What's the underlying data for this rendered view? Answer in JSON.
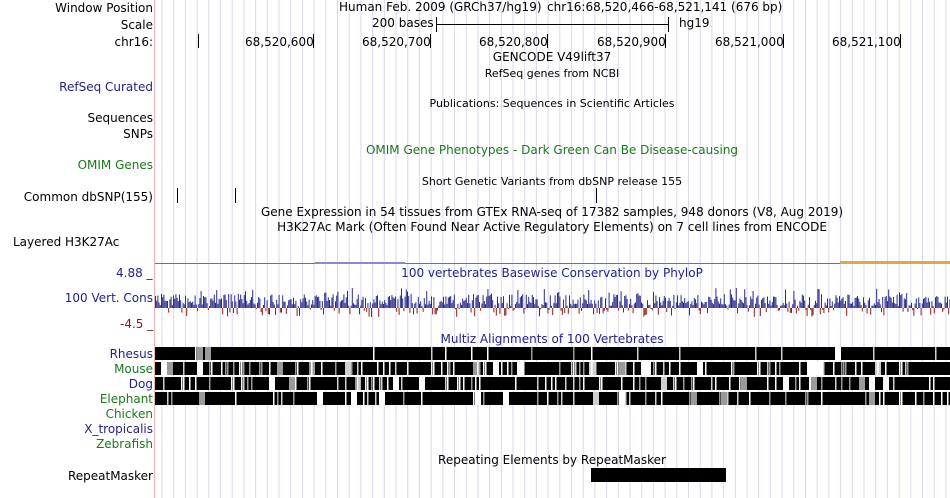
{
  "header": {
    "window_position_label": "Window Position",
    "scale_label": "Scale",
    "chrom_label": "chr16:",
    "assembly": "Human Feb. 2009 (GRCh37/hg19)",
    "position": "chr16:68,520,466-68,521,141 (676 bp)",
    "scale_text": "200 bases",
    "scale_db": "hg19",
    "ruler_ticks": [
      "68,520,600",
      "68,520,700",
      "68,520,800",
      "68,520,900",
      "68,521,000",
      "68,521,100"
    ]
  },
  "tracks": {
    "gencode": {
      "title": "GENCODE V49lift37"
    },
    "refseq": {
      "label": "RefSeq Curated",
      "title": "RefSeq genes from NCBI"
    },
    "publications": {
      "title": "Publications: Sequences in Scientific Articles"
    },
    "sequences": {
      "label": "Sequences"
    },
    "snps": {
      "label": "SNPs"
    },
    "omim": {
      "label": "OMIM Genes",
      "title": "OMIM Gene Phenotypes - Dark Green Can Be Disease-causing"
    },
    "dbsnp": {
      "label": "Common dbSNP(155)",
      "title": "Short Genetic Variants from dbSNP release 155"
    },
    "gtex": {
      "title": "Gene Expression in 54 tissues from GTEx RNA-seq of 17382 samples, 948 donors (V8, Aug 2019)"
    },
    "h3k27ac": {
      "label": "Layered H3K27Ac",
      "title": "H3K27Ac Mark (Often Found Near Active Regulatory Elements) on 7 cell lines from ENCODE"
    },
    "conservation": {
      "label": "100 Vert. Cons",
      "max": "4.88 _",
      "min": "-4.5 _",
      "title": "100 vertebrates Basewise Conservation by PhyloP"
    },
    "multiz": {
      "title": "Multiz Alignments of 100 Vertebrates",
      "species": [
        "Rhesus",
        "Mouse",
        "Dog",
        "Elephant",
        "Chicken",
        "X_tropicalis",
        "Zebrafish"
      ]
    },
    "repeatmasker": {
      "label": "RepeatMasker",
      "title": "Repeating Elements by RepeatMasker"
    }
  },
  "colors": {
    "label_blue": "#1f1f8f",
    "label_green": "#1a7a1a",
    "cons_positive": "#2b2b8c",
    "cons_negative": "#8b1a1a",
    "divider": "#f2b3b3",
    "grid": "#d8d8ee"
  }
}
